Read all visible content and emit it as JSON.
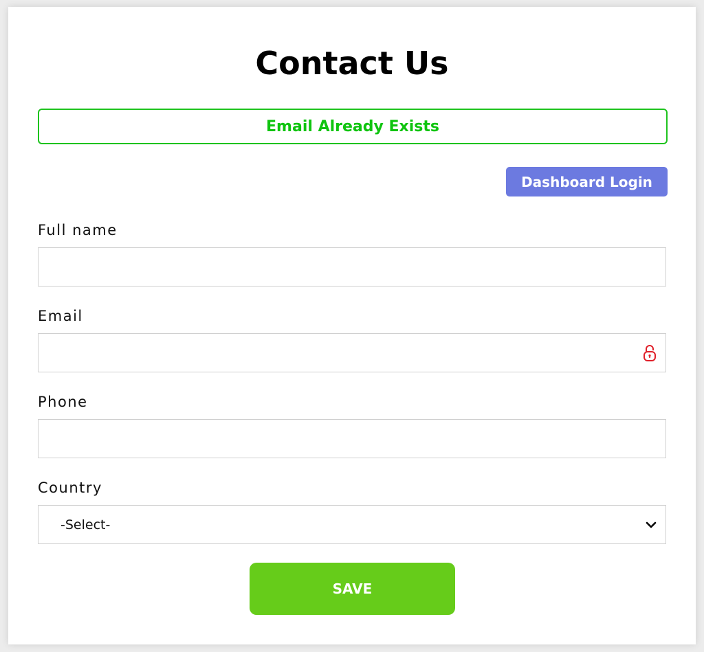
{
  "page": {
    "title": "Contact Us"
  },
  "alert": {
    "message": "Email Already Exists",
    "color": "#0fc40f"
  },
  "header_actions": {
    "dashboard_login_label": "Dashboard Login",
    "dashboard_login_color": "#6c7ae0"
  },
  "form": {
    "full_name": {
      "label": "Full name",
      "value": "",
      "placeholder": ""
    },
    "email": {
      "label": "Email",
      "value": "",
      "placeholder": "",
      "icon": "lock-icon",
      "icon_color": "#e0202a"
    },
    "phone": {
      "label": "Phone",
      "value": "",
      "placeholder": ""
    },
    "country": {
      "label": "Country",
      "selected": "-Select-",
      "icon": "chevron-down-icon"
    },
    "save_label": "SAVE",
    "save_color": "#66cc1a"
  }
}
